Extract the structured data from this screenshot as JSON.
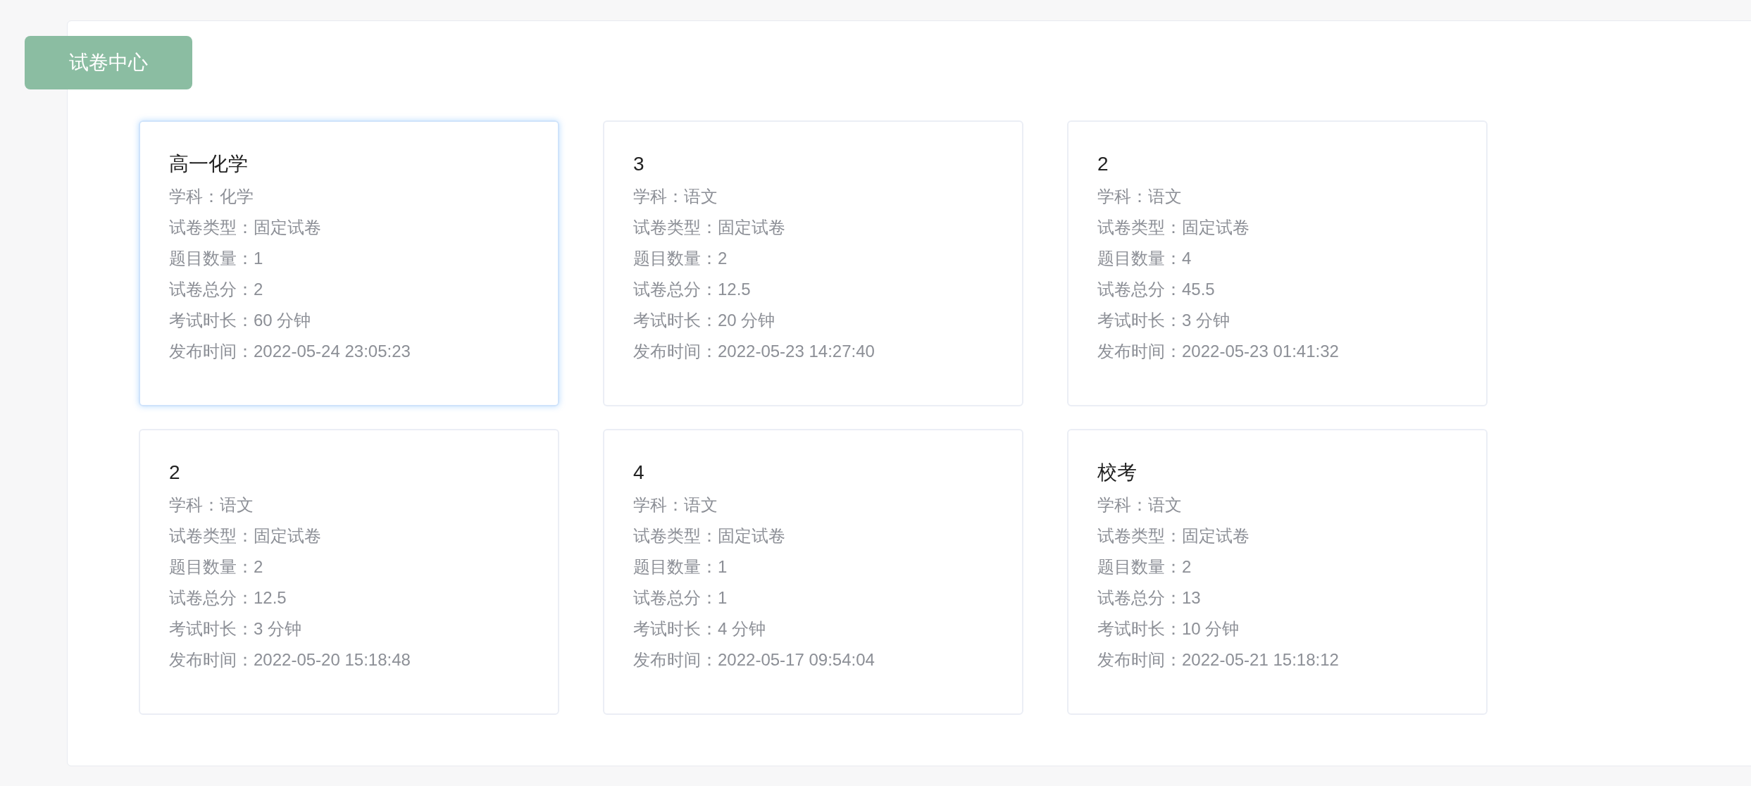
{
  "header_button": "试卷中心",
  "papers": [
    {
      "title": "高一化学",
      "highlighted": true,
      "fields": [
        {
          "label": "学科：",
          "value": "化学"
        },
        {
          "label": "试卷类型：",
          "value": "固定试卷"
        },
        {
          "label": "题目数量：",
          "value": "1"
        },
        {
          "label": "试卷总分：",
          "value": "2"
        },
        {
          "label": "考试时长：",
          "value": "60 分钟"
        },
        {
          "label": "发布时间：",
          "value": "2022-05-24 23:05:23"
        }
      ]
    },
    {
      "title": "3",
      "highlighted": false,
      "fields": [
        {
          "label": "学科：",
          "value": "语文"
        },
        {
          "label": "试卷类型：",
          "value": "固定试卷"
        },
        {
          "label": "题目数量：",
          "value": "2"
        },
        {
          "label": "试卷总分：",
          "value": "12.5"
        },
        {
          "label": "考试时长：",
          "value": "20 分钟"
        },
        {
          "label": "发布时间：",
          "value": "2022-05-23 14:27:40"
        }
      ]
    },
    {
      "title": "2",
      "highlighted": false,
      "fields": [
        {
          "label": "学科：",
          "value": "语文"
        },
        {
          "label": "试卷类型：",
          "value": "固定试卷"
        },
        {
          "label": "题目数量：",
          "value": "4"
        },
        {
          "label": "试卷总分：",
          "value": "45.5"
        },
        {
          "label": "考试时长：",
          "value": "3 分钟"
        },
        {
          "label": "发布时间：",
          "value": "2022-05-23 01:41:32"
        }
      ]
    },
    {
      "title": "2",
      "highlighted": false,
      "fields": [
        {
          "label": "学科：",
          "value": "语文"
        },
        {
          "label": "试卷类型：",
          "value": "固定试卷"
        },
        {
          "label": "题目数量：",
          "value": "2"
        },
        {
          "label": "试卷总分：",
          "value": "12.5"
        },
        {
          "label": "考试时长：",
          "value": "3 分钟"
        },
        {
          "label": "发布时间：",
          "value": "2022-05-20 15:18:48"
        }
      ]
    },
    {
      "title": "4",
      "highlighted": false,
      "fields": [
        {
          "label": "学科：",
          "value": "语文"
        },
        {
          "label": "试卷类型：",
          "value": "固定试卷"
        },
        {
          "label": "题目数量：",
          "value": "1"
        },
        {
          "label": "试卷总分：",
          "value": "1"
        },
        {
          "label": "考试时长：",
          "value": "4 分钟"
        },
        {
          "label": "发布时间：",
          "value": "2022-05-17 09:54:04"
        }
      ]
    },
    {
      "title": "校考",
      "highlighted": false,
      "fields": [
        {
          "label": "学科：",
          "value": "语文"
        },
        {
          "label": "试卷类型：",
          "value": "固定试卷"
        },
        {
          "label": "题目数量：",
          "value": "2"
        },
        {
          "label": "试卷总分：",
          "value": "13"
        },
        {
          "label": "考试时长：",
          "value": "10 分钟"
        },
        {
          "label": "发布时间：",
          "value": "2022-05-21 15:18:12"
        }
      ]
    }
  ]
}
